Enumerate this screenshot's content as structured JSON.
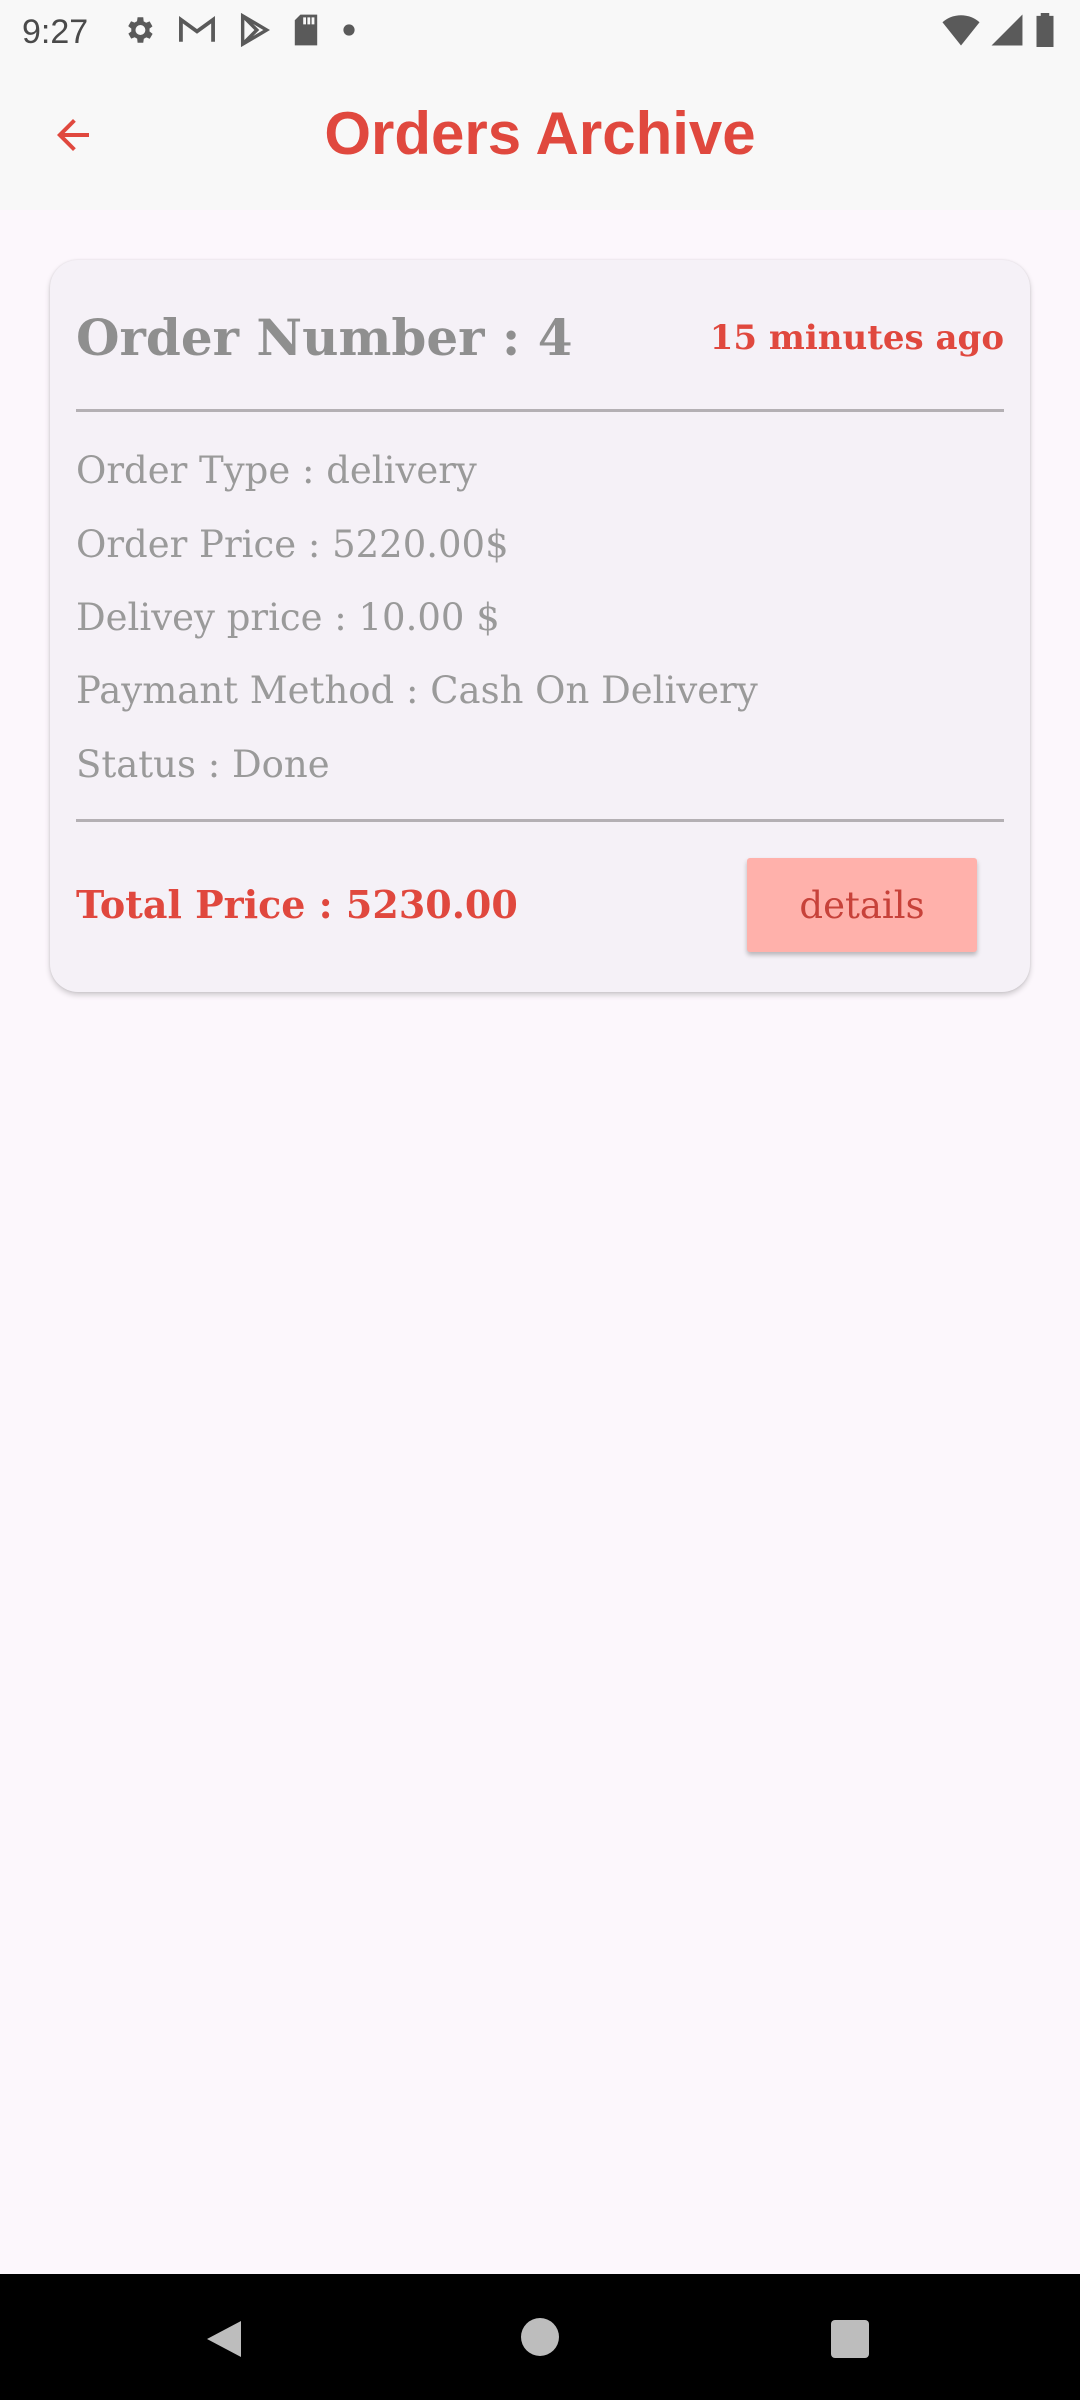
{
  "status_bar": {
    "time": "9:27",
    "left_icons": [
      "settings-gear-icon",
      "gmail-icon",
      "play-store-icon",
      "sd-card-icon",
      "notification-dot-icon"
    ],
    "right_icons": [
      "wifi-icon",
      "cell-signal-icon",
      "battery-icon"
    ]
  },
  "app_bar": {
    "title": "Orders Archive",
    "back_icon": "arrow-left-icon",
    "accent_color": "#e0483e"
  },
  "orders": [
    {
      "number_label": "Order Number  : 4",
      "time_ago": "15 minutes ago",
      "type_line": "Order Type : delivery",
      "price_line": "Order Price :  5220.00$",
      "delivery_line": "Delivey price : 10.00 $",
      "payment_line": "Paymant Method :  Cash On Delivery",
      "status_line": "Status : Done",
      "total_line": "Total Price :  5230.00",
      "details_label": "details"
    }
  ],
  "colors": {
    "background": "#fcf7fc",
    "card": "#f5f1f7",
    "muted_text": "#9a9a9a",
    "button": "#ffb1ab"
  },
  "nav_bar": {
    "icons": [
      "nav-back-icon",
      "nav-home-icon",
      "nav-recents-icon"
    ]
  }
}
